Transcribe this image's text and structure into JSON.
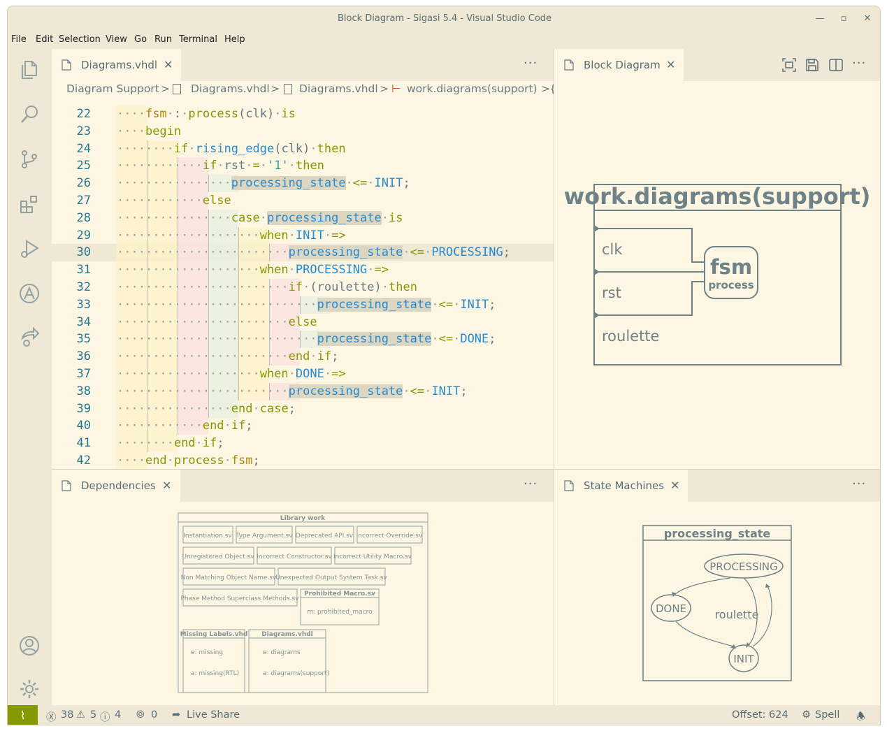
{
  "window": {
    "title": "Block Diagram - Sigasi 5.4 - Visual Studio Code"
  },
  "menu": [
    "File",
    "Edit",
    "Selection",
    "View",
    "Go",
    "Run",
    "Terminal",
    "Help"
  ],
  "activity_icons": [
    "explorer-icon",
    "search-icon",
    "source-control-icon",
    "extensions-icon",
    "run-debug-icon",
    "sigasi-icon",
    "live-share-icon",
    "account-icon",
    "settings-gear-icon"
  ],
  "editor_tab": {
    "label": "Diagrams.vhdl"
  },
  "breadcrumb": [
    "Diagram Support",
    ">",
    "Diagrams.vhdl",
    ">",
    "Diagrams.vhdl",
    ">",
    "work.diagrams(support)",
    ">",
    "{"
  ],
  "code_lines": [
    {
      "n": "22",
      "t": "fsm : process(clk) is"
    },
    {
      "n": "23",
      "t": "begin"
    },
    {
      "n": "24",
      "t": "if rising_edge(clk) then"
    },
    {
      "n": "25",
      "t": "if rst = '1' then"
    },
    {
      "n": "26",
      "t": "processing_state <= INIT;"
    },
    {
      "n": "27",
      "t": "else"
    },
    {
      "n": "28",
      "t": "case processing_state is"
    },
    {
      "n": "29",
      "t": "when INIT =>"
    },
    {
      "n": "30",
      "t": "processing_state <= PROCESSING;"
    },
    {
      "n": "31",
      "t": "when PROCESSING =>"
    },
    {
      "n": "32",
      "t": "if (roulette) then"
    },
    {
      "n": "33",
      "t": "processing_state <= INIT;"
    },
    {
      "n": "34",
      "t": "else"
    },
    {
      "n": "35",
      "t": "processing_state <= DONE;"
    },
    {
      "n": "36",
      "t": "end if;"
    },
    {
      "n": "37",
      "t": "when DONE =>"
    },
    {
      "n": "38",
      "t": "processing_state <= INIT;"
    },
    {
      "n": "39",
      "t": "end case;"
    },
    {
      "n": "40",
      "t": "end if;"
    },
    {
      "n": "41",
      "t": "end if;"
    },
    {
      "n": "42",
      "t": "end process fsm;"
    }
  ],
  "block_diagram": {
    "tab_label": "Block Diagram",
    "title": "work.diagrams(support)",
    "ports": [
      "clk",
      "rst",
      "roulette"
    ],
    "process_name": "fsm",
    "process_kind": "process"
  },
  "dependencies": {
    "tab_label": "Dependencies",
    "library_title": "Library work",
    "row1": [
      "Instantiation.sv",
      "Type Argument.sv",
      "Deprecated API.sv",
      "Incorrect Override.sv"
    ],
    "row2": [
      "Unregistered Object.sv",
      "Incorrect Constructor.sv",
      "Incorrect Utility Macro.sv"
    ],
    "row3": [
      "Non Matching Object Name.sv",
      "Unexpected Output System Task.sv"
    ],
    "row4": [
      "Phase Method Superclass Methods.sv"
    ],
    "prohibited": {
      "title": "Prohibited Macro.sv",
      "item": "m: prohibited_macro"
    },
    "missing": {
      "title": "Missing Labels.vhd",
      "items": [
        "e: missing",
        "a: missing(RTL)"
      ]
    },
    "diagrams": {
      "title": "Diagrams.vhdl",
      "items": [
        "e: diagrams",
        "a: diagrams(support)"
      ]
    }
  },
  "state_machines": {
    "tab_label": "State Machines",
    "title": "processing_state",
    "states": [
      "PROCESSING",
      "DONE",
      "INIT"
    ],
    "transition_label": "roulette"
  },
  "status": {
    "errors": "38",
    "warnings": "5",
    "infos": "4",
    "ports": "0",
    "live_share": "Live Share",
    "offset": "Offset: 624",
    "spell": "Spell"
  },
  "colors": {
    "background": "#fdf6e3",
    "chrome": "#eee8d5",
    "keyword": "#859900",
    "identifier": "#268bd2",
    "string": "#2aa198",
    "diagram": "#6f8288"
  }
}
